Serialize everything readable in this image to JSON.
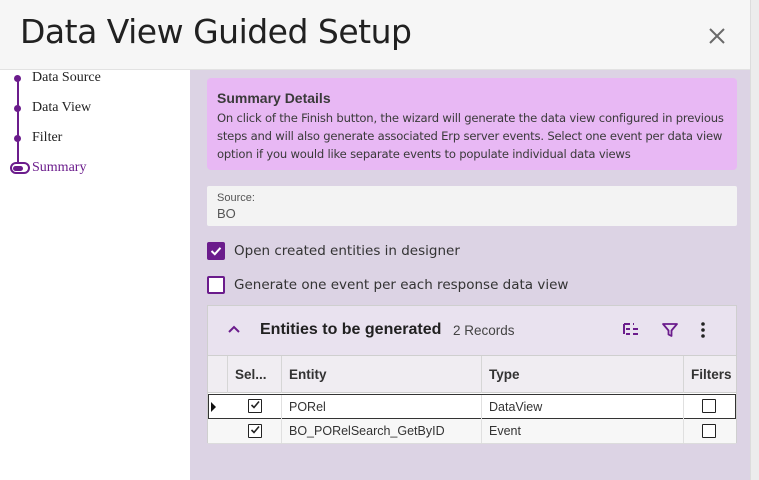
{
  "dialog": {
    "title": "Data View Guided Setup",
    "close_icon": "close-icon"
  },
  "steps": [
    {
      "label": "Data Source",
      "state": "done"
    },
    {
      "label": "Data View",
      "state": "done"
    },
    {
      "label": "Filter",
      "state": "done"
    },
    {
      "label": "Summary",
      "state": "active"
    }
  ],
  "summary": {
    "title": "Summary Details",
    "text": "On click of the Finish button, the wizard will generate the data view configured in previous steps and will also generate associated Erp server events. Select one event per data view option if you would like separate events to populate individual data views"
  },
  "source": {
    "label": "Source:",
    "value": "BO"
  },
  "options": {
    "open_in_designer": {
      "label": "Open created entities in designer",
      "checked": true
    },
    "one_event_per_view": {
      "label": "Generate one event per each response data view",
      "checked": false
    }
  },
  "grid": {
    "title": "Entities to be generated",
    "records": "2 Records",
    "columns": [
      "Sel...",
      "Entity",
      "Type",
      "Filters"
    ],
    "rows": [
      {
        "selected": true,
        "entity": "PORel",
        "type": "DataView",
        "filters": false,
        "current": true
      },
      {
        "selected": true,
        "entity": "BO_PORelSearch_GetByID",
        "type": "Event",
        "filters": false,
        "current": false
      }
    ]
  },
  "colors": {
    "accent": "#6b1c8c",
    "summary_bg": "#e8b8f4",
    "panel_bg": "#dcd3e4"
  }
}
